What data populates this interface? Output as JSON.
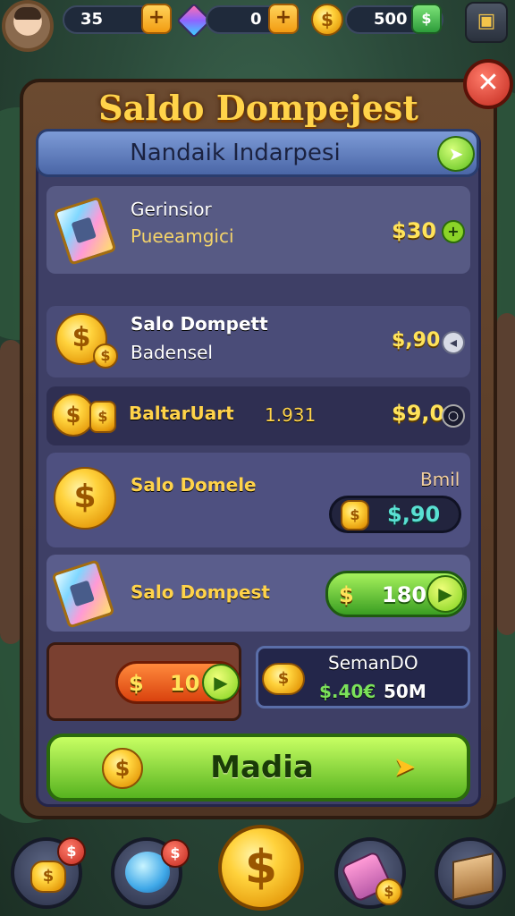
{
  "top_bar": {
    "stat1_value": "35",
    "stat2_value": "0",
    "stat3_value": "500",
    "plus_symbol": "+",
    "coin_symbol": "$"
  },
  "dialog": {
    "title": "Saldo Dompejest",
    "close_symbol": "✕",
    "subheader": "Nandaik Indarpesi",
    "go_symbol": "➤"
  },
  "rows": [
    {
      "title": "Gerinsior",
      "subtitle": "Pueeamgici",
      "price": "$30",
      "action_symbol": "+"
    },
    {
      "title": "Salo Dompett",
      "subtitle": "Badensel",
      "price": "$,90",
      "action_symbol": "◂"
    },
    {
      "title": "BaltarUart",
      "value": "1.931",
      "price": "$9,0",
      "action_symbol": "○"
    },
    {
      "title": "Salo Domele",
      "tag": "Bmil",
      "price": "$,90"
    },
    {
      "title": "Salo Dompest",
      "price_symbol": "$",
      "price": "180",
      "arrow_symbol": "▶"
    }
  ],
  "bottom_row": {
    "left_symbol": "$",
    "left_value": "10",
    "left_arrow": "▶",
    "right_title": "SemanDO",
    "right_price": "$.40€",
    "right_amount": "50M"
  },
  "primary_button": {
    "label": "Madia",
    "coin_symbol": "$",
    "arrow_symbol": "➤"
  },
  "bottom_nav": {
    "badge1": "$",
    "badge2": "$",
    "center_symbol": "$"
  },
  "colors": {
    "title": "#ffd34a",
    "panel": "#3e3f66",
    "accent_green": "#57b320",
    "price_gold": "#ffe35a"
  }
}
